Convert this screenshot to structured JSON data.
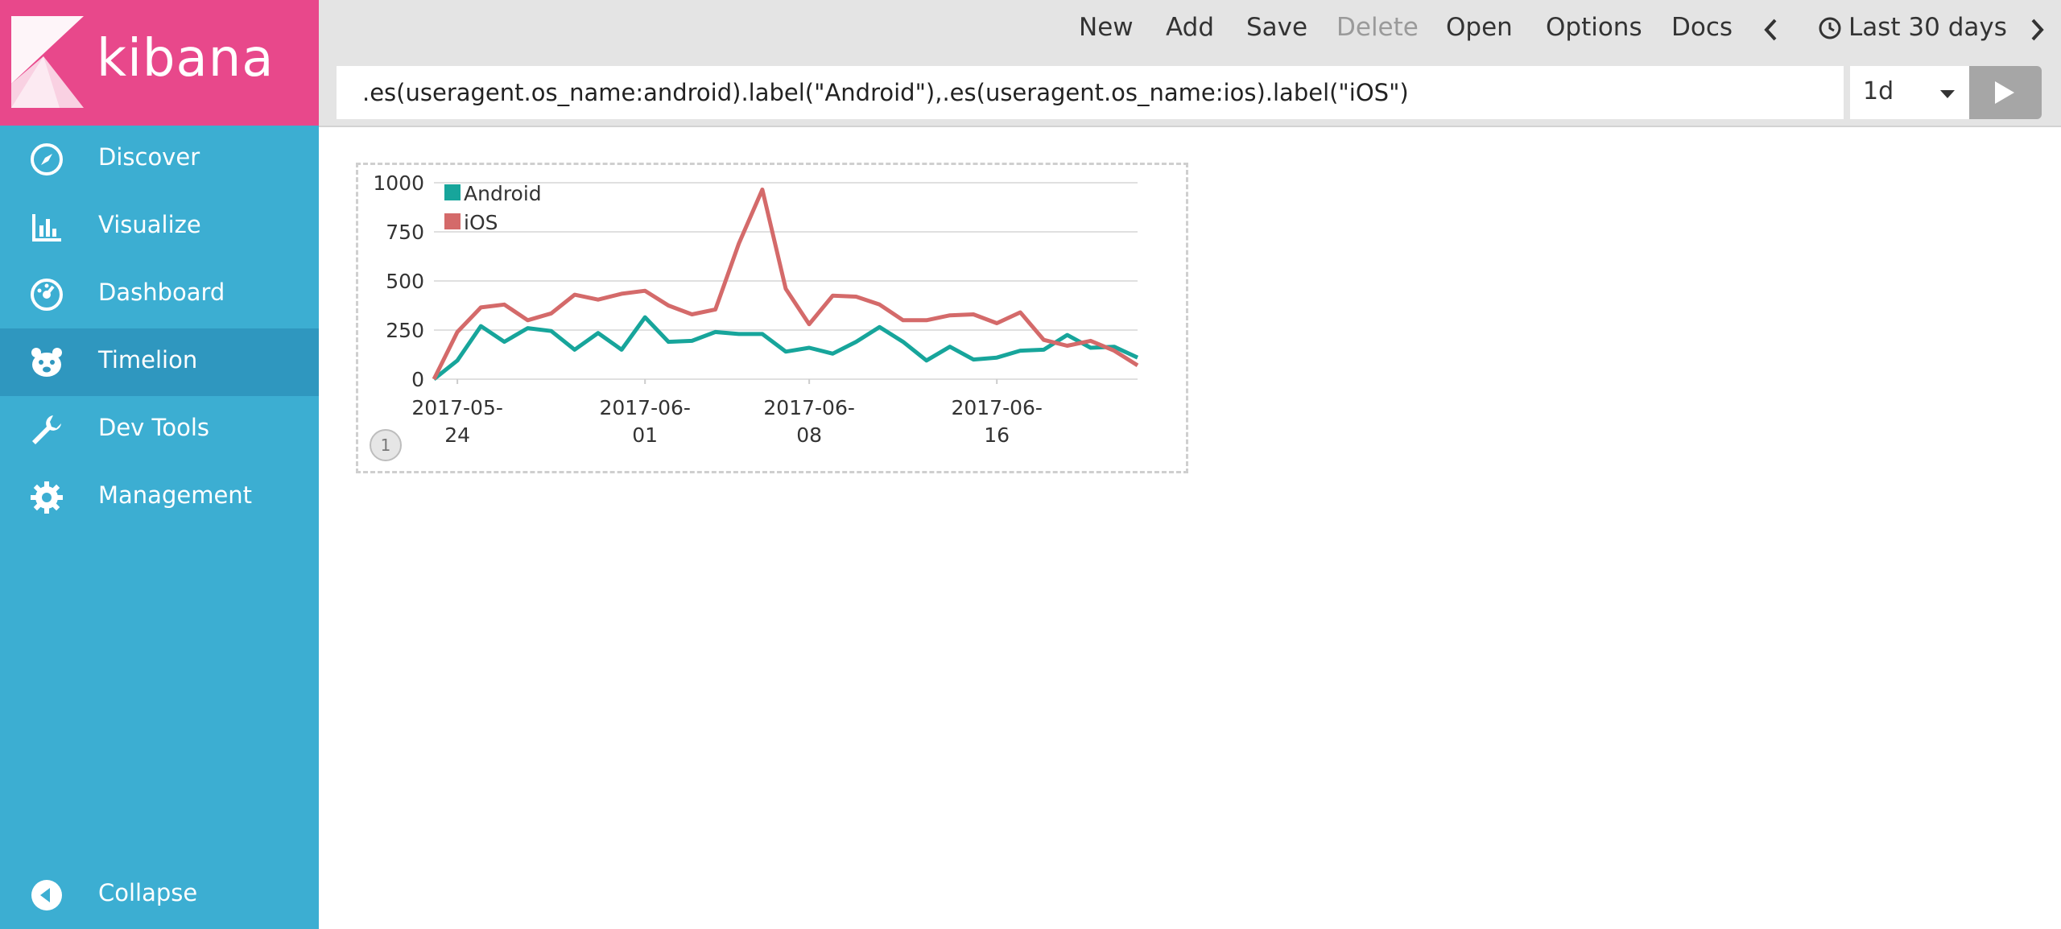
{
  "app": {
    "brand": "kibana"
  },
  "sidebar": {
    "items": [
      {
        "label": "Discover",
        "icon": "compass-icon"
      },
      {
        "label": "Visualize",
        "icon": "bar-chart-icon"
      },
      {
        "label": "Dashboard",
        "icon": "dashboard-gauge-icon"
      },
      {
        "label": "Timelion",
        "icon": "bear-icon",
        "active": true
      },
      {
        "label": "Dev Tools",
        "icon": "wrench-icon"
      },
      {
        "label": "Management",
        "icon": "gear-icon"
      }
    ],
    "collapse_label": "Collapse"
  },
  "topbar": {
    "menu": {
      "new": "New",
      "add": "Add",
      "save": "Save",
      "delete": "Delete",
      "open": "Open",
      "options": "Options",
      "docs": "Docs"
    },
    "time_range": "Last 30 days"
  },
  "query": {
    "expression": ".es(useragent.os_name:android).label(\"Android\"),.es(useragent.os_name:ios).label(\"iOS\")",
    "interval": "1d"
  },
  "panel": {
    "index_badge": "1"
  },
  "colors": {
    "android": "#17a59b",
    "ios": "#d46a6a",
    "brand": "#e8488b",
    "sidebar": "#3caed2"
  },
  "chart_data": {
    "type": "line",
    "x": [
      "2017-05-23",
      "2017-05-24",
      "2017-05-25",
      "2017-05-26",
      "2017-05-27",
      "2017-05-28",
      "2017-05-29",
      "2017-05-30",
      "2017-05-31",
      "2017-06-01",
      "2017-06-02",
      "2017-06-03",
      "2017-06-04",
      "2017-06-05",
      "2017-06-06",
      "2017-06-07",
      "2017-06-08",
      "2017-06-09",
      "2017-06-10",
      "2017-06-11",
      "2017-06-12",
      "2017-06-13",
      "2017-06-14",
      "2017-06-15",
      "2017-06-16",
      "2017-06-17",
      "2017-06-18",
      "2017-06-19",
      "2017-06-20",
      "2017-06-21",
      "2017-06-22"
    ],
    "x_ticks": [
      "2017-05-24",
      "2017-06-01",
      "2017-06-08",
      "2017-06-16"
    ],
    "y_ticks": [
      0,
      250,
      500,
      750,
      1000
    ],
    "ylim": [
      0,
      1000
    ],
    "legend": "top-left",
    "grid": true,
    "series": [
      {
        "name": "Android",
        "color": "#17a59b",
        "values": [
          0,
          95,
          270,
          190,
          260,
          245,
          150,
          235,
          150,
          315,
          190,
          195,
          240,
          230,
          230,
          140,
          160,
          130,
          190,
          265,
          190,
          95,
          165,
          100,
          110,
          145,
          150,
          225,
          160,
          165,
          110
        ]
      },
      {
        "name": "iOS",
        "color": "#d46a6a",
        "values": [
          0,
          240,
          365,
          380,
          300,
          335,
          430,
          405,
          435,
          450,
          375,
          330,
          355,
          690,
          965,
          460,
          280,
          425,
          420,
          380,
          300,
          300,
          325,
          330,
          285,
          340,
          200,
          170,
          195,
          145,
          70
        ]
      }
    ]
  }
}
